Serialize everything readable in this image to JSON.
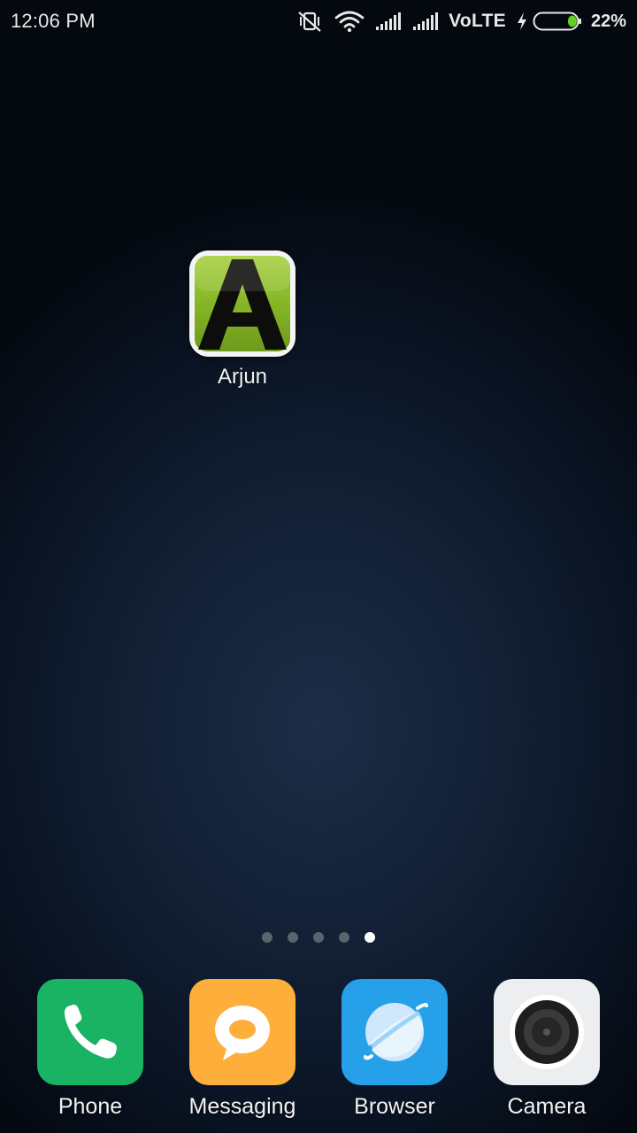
{
  "status_bar": {
    "time": "12:06 PM",
    "network": "VoLTE",
    "battery_percent": "22%",
    "battery_level": 0.22,
    "battery_color": "#5fd11e",
    "icons": [
      "vibrate-off-icon",
      "wifi-icon",
      "signal-sim1-icon",
      "signal-sim2-icon",
      "charging-bolt-icon",
      "battery-icon"
    ]
  },
  "home": {
    "apps": [
      {
        "label": "Arjun",
        "icon": "arjun-a-logo-icon"
      }
    ]
  },
  "page_indicator": {
    "total_pages": 5,
    "active_page": 5
  },
  "dock": {
    "apps": [
      {
        "label": "Phone",
        "icon": "phone-icon",
        "color": "#19b363"
      },
      {
        "label": "Messaging",
        "icon": "messaging-icon",
        "color": "#fdae3b"
      },
      {
        "label": "Browser",
        "icon": "browser-icon",
        "color": "#27a0ea"
      },
      {
        "label": "Camera",
        "icon": "camera-icon",
        "color": "#eceef0"
      }
    ]
  }
}
